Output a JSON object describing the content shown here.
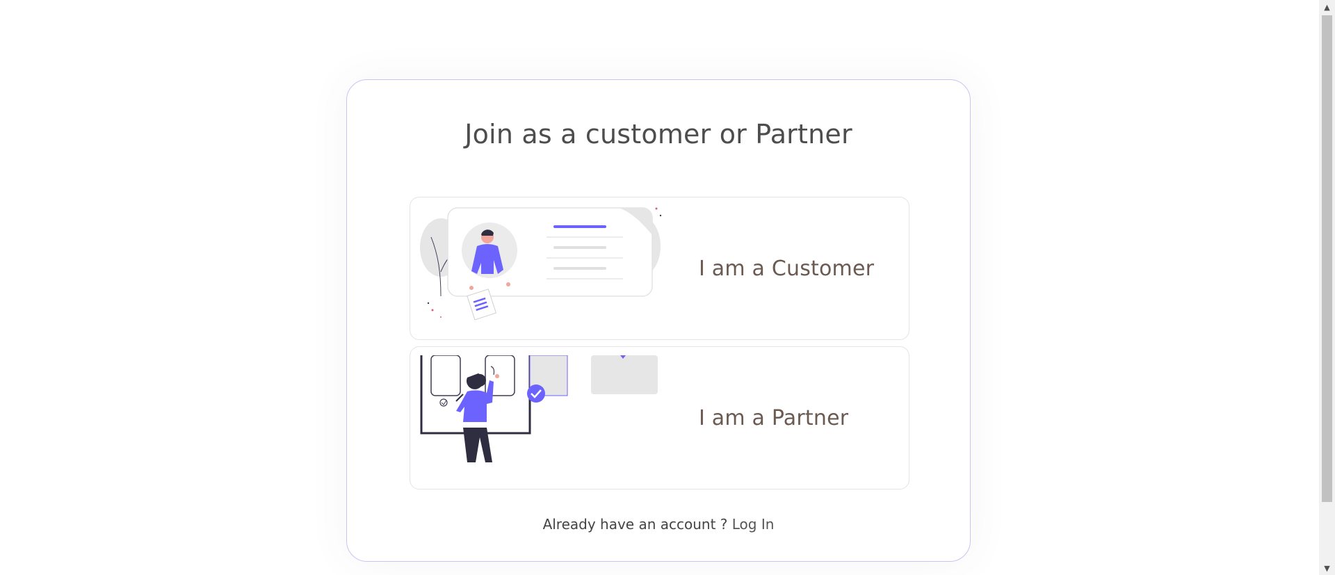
{
  "heading": "Join as a customer or Partner",
  "options": [
    {
      "label": "I am a Customer",
      "illustration": "customer-profile-illustration"
    },
    {
      "label": "I am a Partner",
      "illustration": "partner-board-illustration"
    }
  ],
  "footer": {
    "prompt": "Already have an account ?",
    "login_label": "Log In"
  },
  "colors": {
    "accent": "#6c63ff",
    "card_border": "#c9c4f5",
    "label_text": "#6b5a52"
  }
}
